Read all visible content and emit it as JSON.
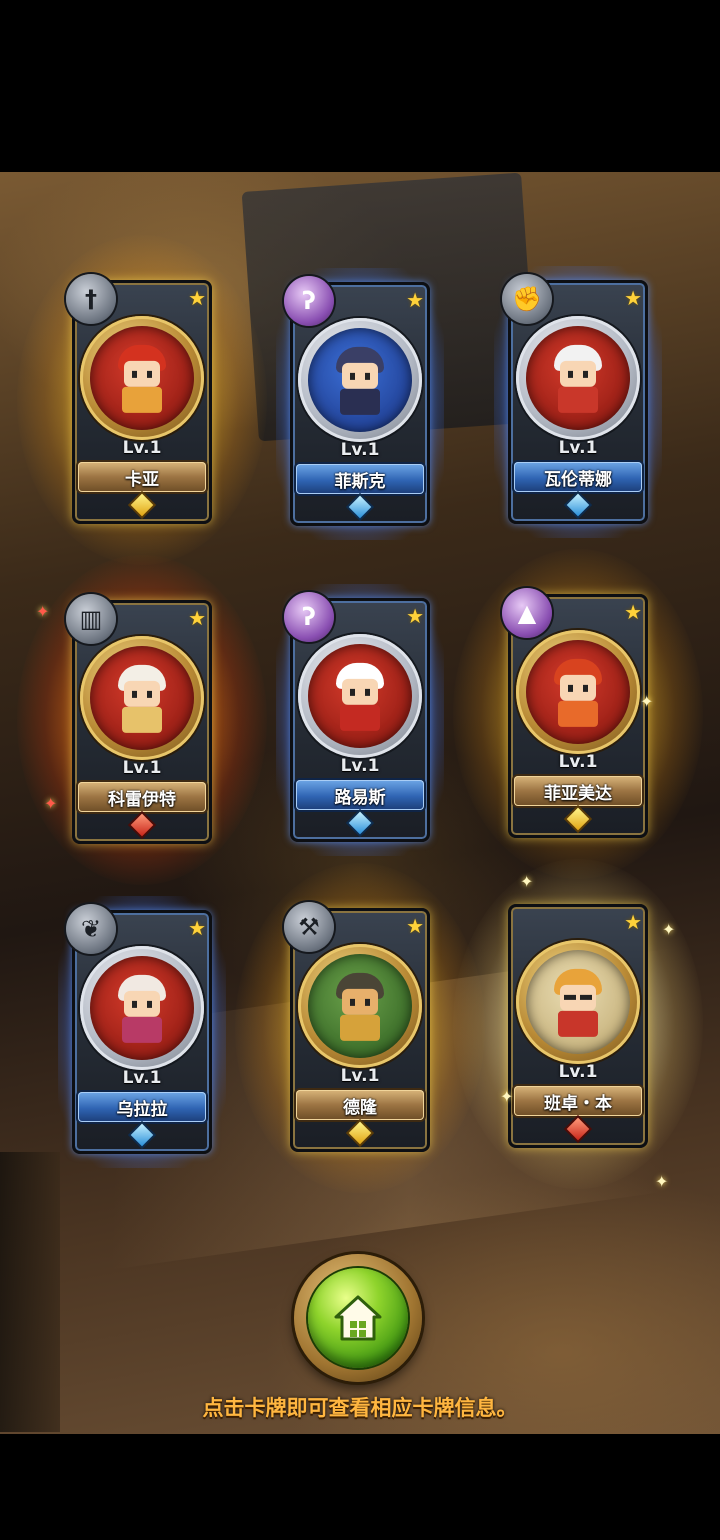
{
  "cards": [
    {
      "name": "卡亚",
      "level": "Lv.1",
      "rarity": "gold",
      "class_icon": "sword-icon",
      "bg": "red"
    },
    {
      "name": "菲斯克",
      "level": "Lv.1",
      "rarity": "blue",
      "class_icon": "magic-orb-icon",
      "bg": "blue"
    },
    {
      "name": "瓦伦蒂娜",
      "level": "Lv.1",
      "rarity": "blue",
      "class_icon": "fist-icon",
      "bg": "red"
    },
    {
      "name": "科雷伊特",
      "level": "Lv.1",
      "rarity": "fire",
      "class_icon": "book-icon",
      "bg": "red"
    },
    {
      "name": "路易斯",
      "level": "Lv.1",
      "rarity": "blue",
      "class_icon": "magic-orb-icon",
      "bg": "red"
    },
    {
      "name": "菲亚美达",
      "level": "Lv.1",
      "rarity": "gold",
      "class_icon": "wizard-hat-icon",
      "bg": "red"
    },
    {
      "name": "乌拉拉",
      "level": "Lv.1",
      "rarity": "blue",
      "class_icon": "wings-icon",
      "bg": "red"
    },
    {
      "name": "德隆",
      "level": "Lv.1",
      "rarity": "gold",
      "class_icon": "axe-icon",
      "bg": "green"
    },
    {
      "name": "班卓・本",
      "level": "Lv.1",
      "rarity": "white",
      "class_icon": "none",
      "bg": "sand"
    }
  ],
  "home_button": {
    "icon": "home-icon"
  },
  "hint_text": "点击卡牌即可查看相应卡牌信息。"
}
